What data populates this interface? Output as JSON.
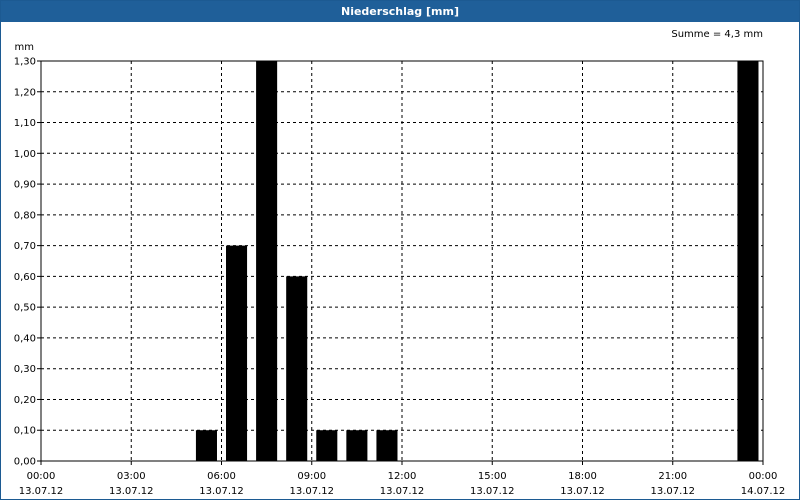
{
  "window": {
    "title": "Niederschlag [mm]"
  },
  "chart_data": {
    "type": "bar",
    "title": "Niederschlag [mm]",
    "ylabel": "mm",
    "annotation": "Summe = 4,3 mm",
    "ylim": [
      0,
      1.3
    ],
    "yticks": [
      "0,00",
      "0,10",
      "0,20",
      "0,30",
      "0,40",
      "0,50",
      "0,60",
      "0,70",
      "0,80",
      "0,90",
      "1,00",
      "1,10",
      "1,20",
      "1,30"
    ],
    "xlim_hours": [
      0,
      24
    ],
    "xticks": [
      {
        "time": "00:00",
        "date": "13.07.12"
      },
      {
        "time": "03:00",
        "date": "13.07.12"
      },
      {
        "time": "06:00",
        "date": "13.07.12"
      },
      {
        "time": "09:00",
        "date": "13.07.12"
      },
      {
        "time": "12:00",
        "date": "13.07.12"
      },
      {
        "time": "15:00",
        "date": "13.07.12"
      },
      {
        "time": "18:00",
        "date": "13.07.12"
      },
      {
        "time": "21:00",
        "date": "13.07.12"
      },
      {
        "time": "00:00",
        "date": "14.07.12"
      }
    ],
    "x": [
      "05:30",
      "06:30",
      "07:30",
      "08:30",
      "09:30",
      "10:30",
      "11:30",
      "23:30"
    ],
    "values": [
      0.1,
      0.7,
      1.3,
      0.6,
      0.1,
      0.1,
      0.1,
      1.3
    ],
    "bar_color": "#000000",
    "grid": true
  }
}
